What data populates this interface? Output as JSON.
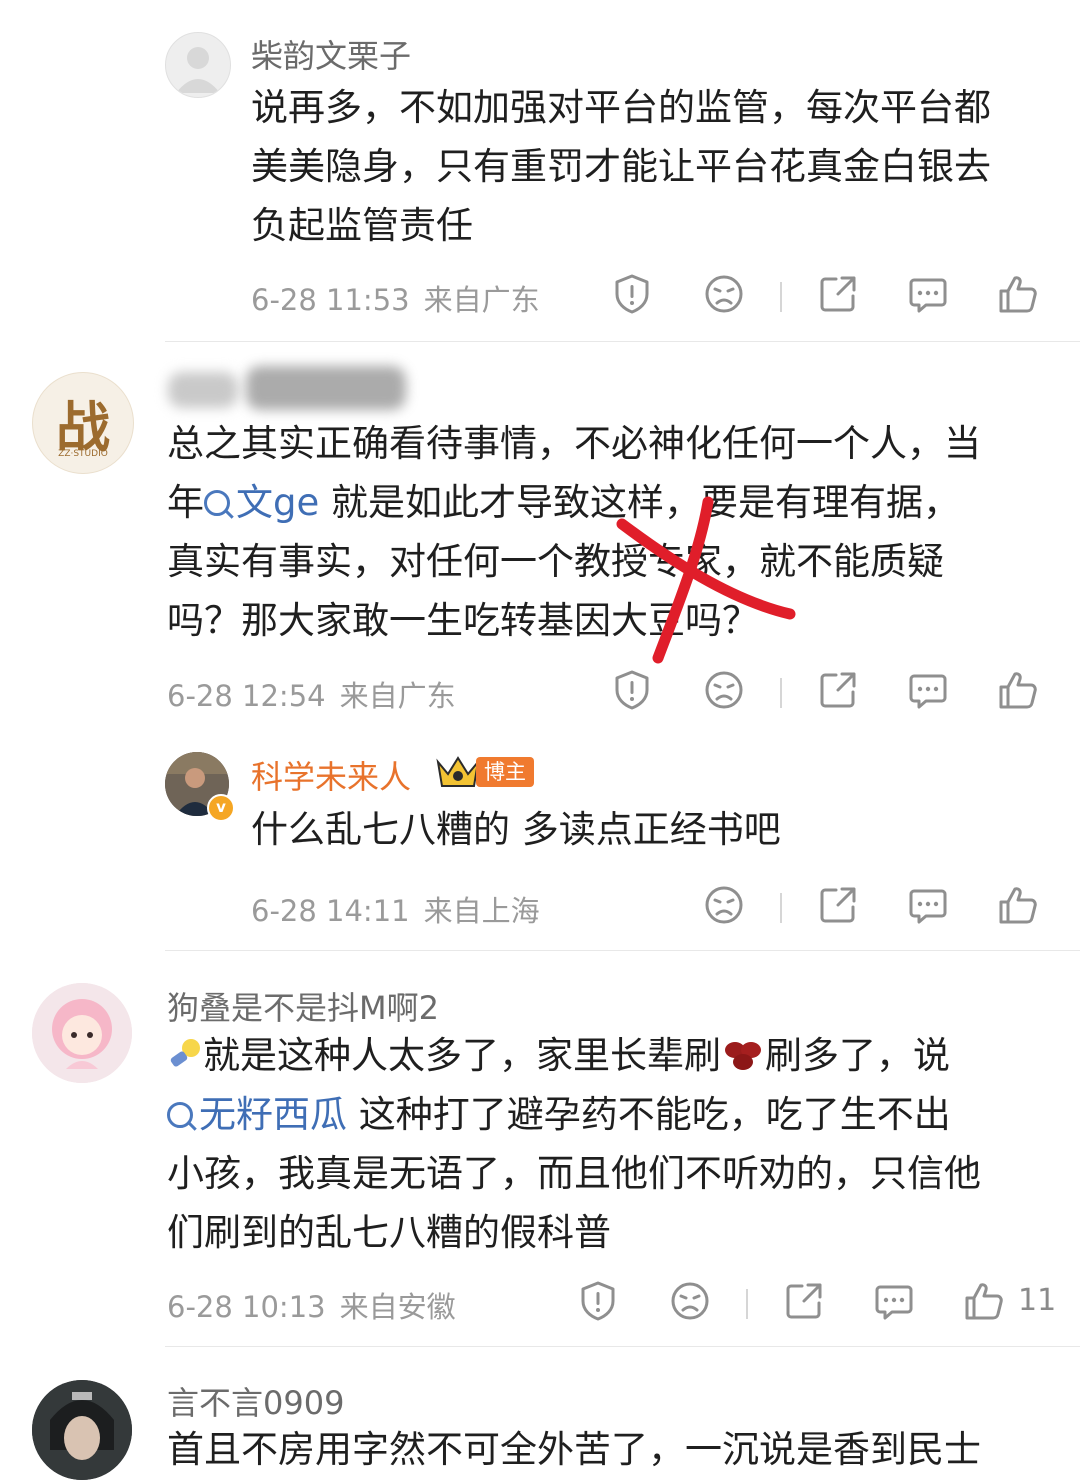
{
  "comments": [
    {
      "username": "柴韵文栗子",
      "lines": [
        "说再多，不如加强对平台的监管，每次平台都",
        "美美隐身，只有重罚才能让平台花真金白银去",
        "负起监管责任"
      ],
      "time": "6-28 11:53",
      "location": "来自广东"
    },
    {
      "avatar_char": "战",
      "avatar_sub": "ZZ·STUDIO",
      "line1": "总之其实正确看待事情，不必神化任何一个人，当",
      "line2_a": "年",
      "line2_topic": "文ge",
      "line2_b": " 就是如此才导致这样，要是有理有据，",
      "line3": "真实有事实，对任何一个教授专家，就不能质疑",
      "line4": "吗？那大家敢一生吃转基因大豆吗？",
      "time": "6-28 12:54",
      "location": "来自广东"
    },
    {
      "username": "科学未来人",
      "badge": "博主",
      "verified_mark": "v",
      "text": "什么乱七八糟的 多读点正经书吧",
      "time": "6-28 14:11",
      "location": "来自上海"
    },
    {
      "username": "狗叠是不是抖M啊2",
      "line1_a": "就是这种人太多了，家里长辈刷",
      "line1_b": "刷多了，说",
      "line2_topic": "无籽西瓜",
      "line2_b": " 这种打了避孕药不能吃，吃了生不出",
      "line3": "小孩，我真是无语了，而且他们不听劝的，只信他",
      "line4": "们刷到的乱七八糟的假科普",
      "time": "6-28 10:13",
      "location": "来自安徽",
      "likes": "11"
    },
    {
      "username": "言不言0909",
      "partial_line": "首且不房用字然不可全外苦了，一沉说是香到民士"
    }
  ],
  "icons": [
    "report-icon",
    "dislike-icon",
    "share-icon",
    "reply-icon",
    "like-icon"
  ],
  "colors": {
    "topic": "#3f6eb5",
    "vip_name": "#e8732c",
    "annotation": "#e01e2a",
    "meta": "#9a9a9a"
  }
}
